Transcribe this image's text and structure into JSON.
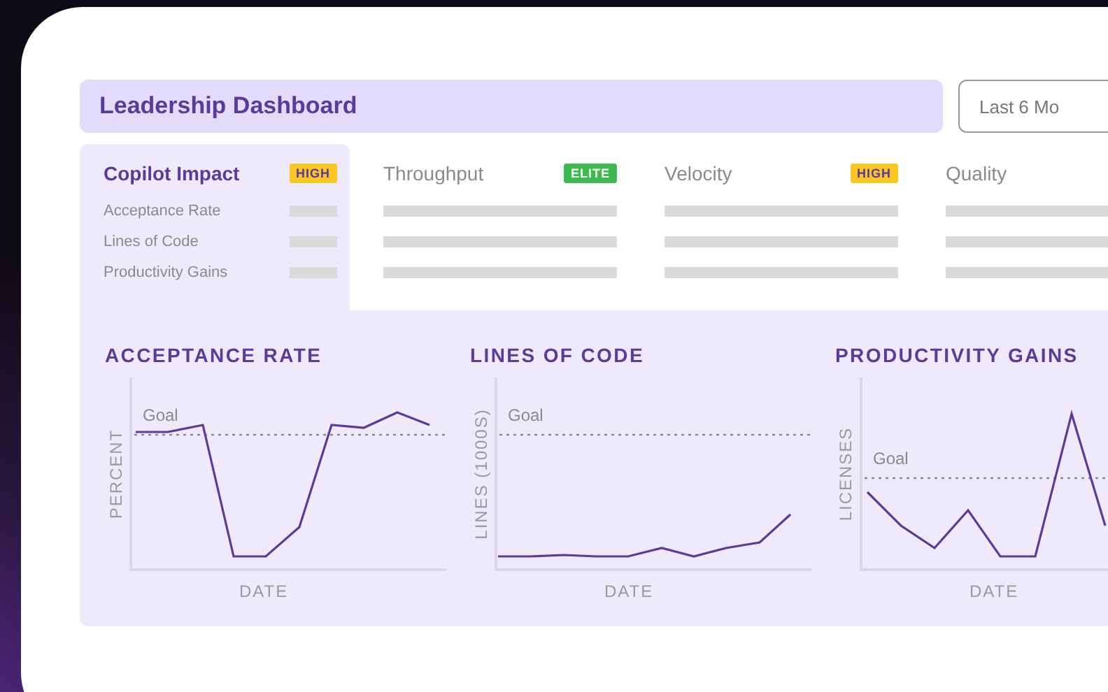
{
  "header": {
    "title": "Leadership Dashboard",
    "period_dropdown": "Last 6 Mo"
  },
  "tabs": [
    {
      "title": "Copilot Impact",
      "selected": true,
      "badge": {
        "label": "HIGH",
        "color": "#f9c623"
      },
      "rows": [
        "Acceptance Rate",
        "Lines of Code",
        "Productivity Gains"
      ]
    },
    {
      "title": "Throughput",
      "selected": false,
      "badge": {
        "label": "ELITE",
        "color": "#3dba4e"
      }
    },
    {
      "title": "Velocity",
      "selected": false,
      "badge": {
        "label": "HIGH",
        "color": "#f9c623"
      }
    },
    {
      "title": "Quality",
      "selected": false
    }
  ],
  "charts": [
    {
      "title": "ACCEPTANCE RATE",
      "ylabel": "PERCENT",
      "xlabel": "DATE",
      "goal_label": "Goal"
    },
    {
      "title": "LINES OF CODE",
      "ylabel": "LINES (1000S)",
      "xlabel": "DATE",
      "goal_label": "Goal"
    },
    {
      "title": "PRODUCTIVITY GAINS",
      "ylabel": "LICENSES",
      "xlabel": "DATE",
      "goal_label": "Goal"
    }
  ]
}
